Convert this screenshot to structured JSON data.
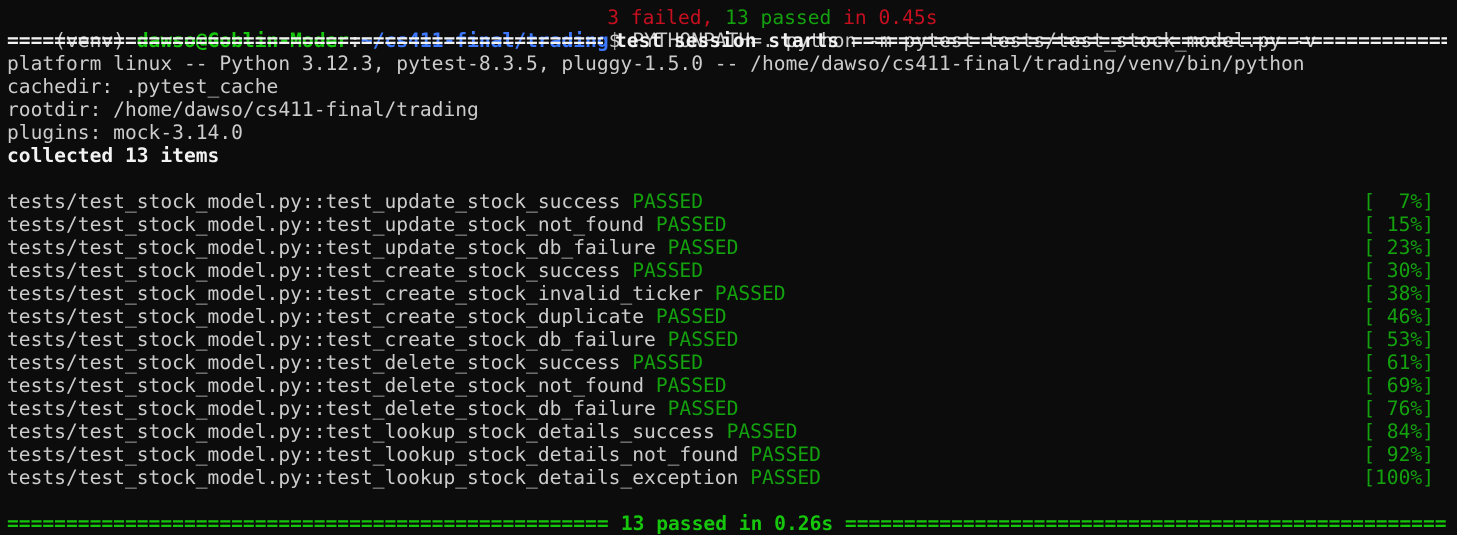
{
  "partial_top_line": {
    "red_text": "3 failed,",
    "green_text": " 13 passed",
    "red_tail": " in 0.45s"
  },
  "prompt": {
    "venv": "(venv) ",
    "user_host": "dawso@Goblin-Moder",
    "sep": ":",
    "path": "~/cs411-final/trading",
    "dollar": "$ ",
    "command": "PYTHONPATH=. python -m pytest tests/test_stock_model.py -v"
  },
  "session_header": "test session starts",
  "info_lines": [
    "platform linux -- Python 3.12.3, pytest-8.3.5, pluggy-1.5.0 -- /home/dawso/cs411-final/trading/venv/bin/python",
    "cachedir: .pytest_cache",
    "rootdir: /home/dawso/cs411-final/trading",
    "plugins: mock-3.14.0"
  ],
  "collected": "collected 13 items",
  "tests": [
    {
      "name": "tests/test_stock_model.py::test_update_stock_success",
      "status": "PASSED",
      "pct": "[  7%]"
    },
    {
      "name": "tests/test_stock_model.py::test_update_stock_not_found",
      "status": "PASSED",
      "pct": "[ 15%]"
    },
    {
      "name": "tests/test_stock_model.py::test_update_stock_db_failure",
      "status": "PASSED",
      "pct": "[ 23%]"
    },
    {
      "name": "tests/test_stock_model.py::test_create_stock_success",
      "status": "PASSED",
      "pct": "[ 30%]"
    },
    {
      "name": "tests/test_stock_model.py::test_create_stock_invalid_ticker",
      "status": "PASSED",
      "pct": "[ 38%]"
    },
    {
      "name": "tests/test_stock_model.py::test_create_stock_duplicate",
      "status": "PASSED",
      "pct": "[ 46%]"
    },
    {
      "name": "tests/test_stock_model.py::test_create_stock_db_failure",
      "status": "PASSED",
      "pct": "[ 53%]"
    },
    {
      "name": "tests/test_stock_model.py::test_delete_stock_success",
      "status": "PASSED",
      "pct": "[ 61%]"
    },
    {
      "name": "tests/test_stock_model.py::test_delete_stock_not_found",
      "status": "PASSED",
      "pct": "[ 69%]"
    },
    {
      "name": "tests/test_stock_model.py::test_delete_stock_db_failure",
      "status": "PASSED",
      "pct": "[ 76%]"
    },
    {
      "name": "tests/test_stock_model.py::test_lookup_stock_details_success",
      "status": "PASSED",
      "pct": "[ 84%]"
    },
    {
      "name": "tests/test_stock_model.py::test_lookup_stock_details_not_found",
      "status": "PASSED",
      "pct": "[ 92%]"
    },
    {
      "name": "tests/test_stock_model.py::test_lookup_stock_details_exception",
      "status": "PASSED",
      "pct": "[100%]"
    }
  ],
  "summary": "13 passed in 0.26s",
  "colors": {
    "background": "#0c0c0c",
    "text": "#cccccc",
    "prompt_user": "#16c60c",
    "prompt_path": "#3b78ff",
    "passed": "#13a10e",
    "failed": "#c50f1f"
  }
}
